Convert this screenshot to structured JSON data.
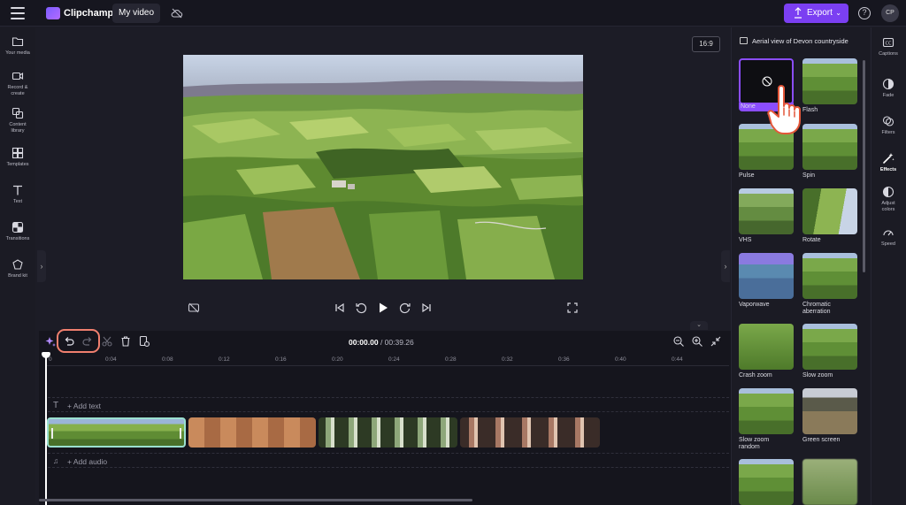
{
  "header": {
    "app_name": "Clipchamp",
    "project_title": "My video",
    "export_label": "Export",
    "help_label": "?",
    "avatar_initials": "CP"
  },
  "left_nav": {
    "items": [
      {
        "label": "Your media",
        "icon": "folder-icon"
      },
      {
        "label": "Record & create",
        "icon": "camera-icon"
      },
      {
        "label": "Content library",
        "icon": "library-icon"
      },
      {
        "label": "Templates",
        "icon": "templates-icon"
      },
      {
        "label": "Text",
        "icon": "text-icon"
      },
      {
        "label": "Transitions",
        "icon": "transitions-icon"
      },
      {
        "label": "Brand kit",
        "icon": "brand-kit-icon"
      }
    ]
  },
  "preview": {
    "aspect_ratio": "16:9"
  },
  "timeline": {
    "current_time": "00:00.00",
    "total_time": "/ 00:39.26",
    "ruler": [
      "0",
      "0:04",
      "0:08",
      "0:12",
      "0:16",
      "0:20",
      "0:24",
      "0:28",
      "0:32",
      "0:36",
      "0:40",
      "0:44"
    ],
    "add_text_label": "+ Add text",
    "add_audio_label": "+ Add audio"
  },
  "effects_panel": {
    "title": "Aerial view of Devon countryside",
    "effects": [
      {
        "name": "None",
        "selected": true
      },
      {
        "name": "Flash"
      },
      {
        "name": "Pulse"
      },
      {
        "name": "Spin"
      },
      {
        "name": "VHS"
      },
      {
        "name": "Rotate"
      },
      {
        "name": "Vaporwave"
      },
      {
        "name": "Chromatic aberration"
      },
      {
        "name": "Crash zoom"
      },
      {
        "name": "Slow zoom"
      },
      {
        "name": "Slow zoom random"
      },
      {
        "name": "Green screen"
      },
      {
        "name": ""
      },
      {
        "name": ""
      }
    ]
  },
  "right_nav": {
    "items": [
      {
        "label": "Captions",
        "icon": "captions-icon"
      },
      {
        "label": "Fade",
        "icon": "fade-icon"
      },
      {
        "label": "Filters",
        "icon": "filters-icon"
      },
      {
        "label": "Effects",
        "icon": "magic-wand-icon",
        "active": true
      },
      {
        "label": "Adjust colors",
        "icon": "adjust-colors-icon"
      },
      {
        "label": "Speed",
        "icon": "speed-icon"
      }
    ]
  },
  "colors": {
    "accent": "#7b3ff2",
    "highlight": "#f07f6e",
    "selected_clip_border": "#9be0d0"
  }
}
